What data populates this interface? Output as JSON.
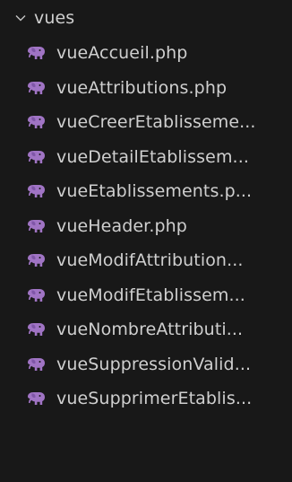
{
  "explorer": {
    "folder": {
      "name": "vues",
      "expanded": true,
      "chevron_icon": "chevron-down-icon"
    },
    "file_icon": "php-elephant-icon",
    "file_icon_color": "#a074c4",
    "files": [
      {
        "name": "vueAccueil.php"
      },
      {
        "name": "vueAttributions.php"
      },
      {
        "name": "vueCreerEtablisseme..."
      },
      {
        "name": "vueDetailEtablissem..."
      },
      {
        "name": "vueEtablissements.p..."
      },
      {
        "name": "vueHeader.php"
      },
      {
        "name": "vueModifAttribution..."
      },
      {
        "name": "vueModifEtablissem..."
      },
      {
        "name": "vueNombreAttributi..."
      },
      {
        "name": "vueSuppressionValid..."
      },
      {
        "name": "vueSupprimerEtablis..."
      }
    ]
  }
}
